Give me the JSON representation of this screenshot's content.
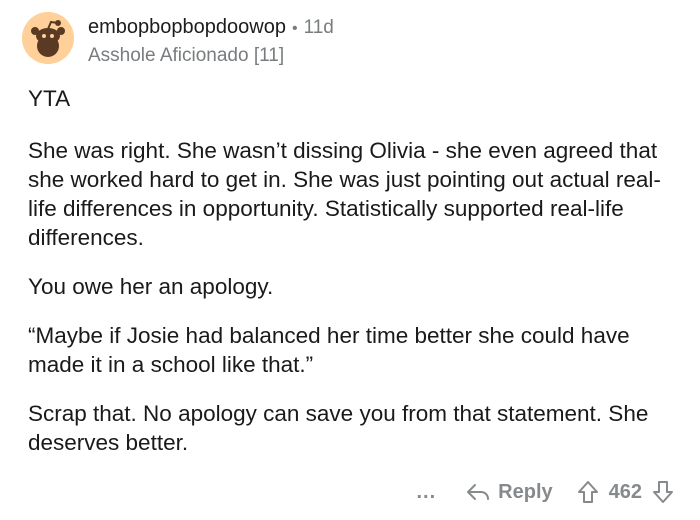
{
  "comment": {
    "username": "embopbopbopdoowop",
    "separator": "•",
    "time": "11d",
    "flair": "Asshole Aficionado [11]",
    "paragraphs": [
      "YTA",
      "She was right. She wasn’t dissing Olivia - she even agreed that she worked hard to get in. She was just pointing out actual real-life differences in opportunity. Statistically supported real-life differences.",
      "You owe her an apology.",
      "“Maybe if Josie had balanced her time better she could have made it in a school like that.”",
      "Scrap that. No apology can save you from that statement. She deserves better."
    ]
  },
  "actions": {
    "more": "...",
    "reply_label": "Reply",
    "score": "462"
  },
  "icons": {
    "avatar": "snoo-avatar-icon",
    "reply": "reply-arrow-icon",
    "upvote": "upvote-arrow-icon",
    "downvote": "downvote-arrow-icon"
  },
  "colors": {
    "avatar_bg": "#ffd09a",
    "muted": "#787c7e"
  }
}
